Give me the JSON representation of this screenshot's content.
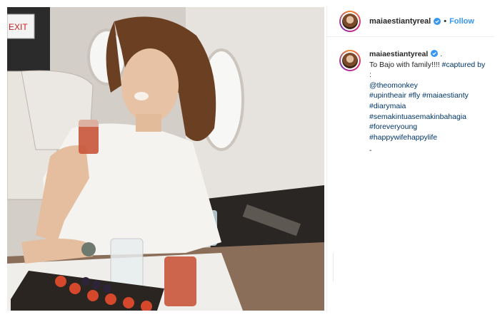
{
  "post": {
    "username": "maiaestiantyreal",
    "verified": true,
    "separator": "•",
    "follow_label": "Follow"
  },
  "caption": {
    "username": "maiaestiantyreal",
    "after_name": " .",
    "text_line1": "To Bajo with family!!!! ",
    "tags_line1": "#captured by :",
    "mention": "@theomonkey",
    "tags_line2": "#upintheair #fly #maiaestianty",
    "tags_line3": "#diarymaia",
    "tags_line4": "#semakintuasemakinbahagia",
    "tags_line5": "#foreveryoung #happywifehappylife",
    "trailer": "-"
  },
  "photo": {
    "exit_sign": "EXIT"
  },
  "colors": {
    "link": "#3897f0",
    "tag": "#003569",
    "verified": "#3897f0"
  }
}
